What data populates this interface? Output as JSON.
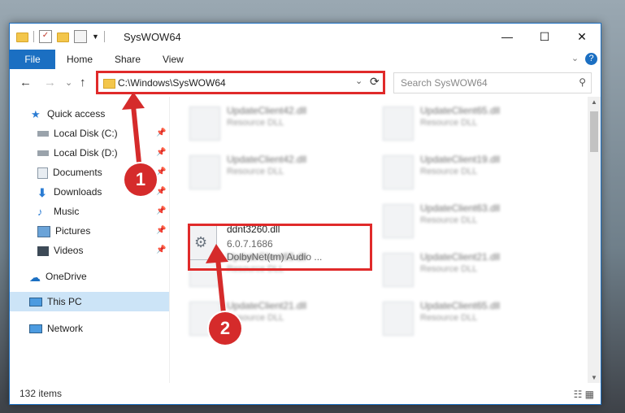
{
  "window": {
    "title": "SysWOW64",
    "controls": {
      "minimize": "—",
      "maximize": "☐",
      "close": "✕"
    }
  },
  "ribbon": {
    "tabs": [
      "File",
      "Home",
      "Share",
      "View"
    ],
    "expand": "⌄",
    "help": "?"
  },
  "navigation": {
    "back": "←",
    "forward": "→",
    "recent": "⌄",
    "up": "↑",
    "address": "C:\\Windows\\SysWOW64",
    "address_dropdown": "⌄",
    "refresh": "⟳",
    "search_placeholder": "Search SysWOW64"
  },
  "sidebar": {
    "items": [
      {
        "label": "Quick access",
        "icon": "star-icon"
      },
      {
        "label": "Local Disk (C:)",
        "icon": "drive-icon",
        "pinned": true
      },
      {
        "label": "Local Disk (D:)",
        "icon": "drive-icon",
        "pinned": true
      },
      {
        "label": "Documents",
        "icon": "documents-icon",
        "pinned": true
      },
      {
        "label": "Downloads",
        "icon": "download-icon",
        "pinned": true
      },
      {
        "label": "Music",
        "icon": "music-icon",
        "pinned": true
      },
      {
        "label": "Pictures",
        "icon": "pictures-icon",
        "pinned": true
      },
      {
        "label": "Videos",
        "icon": "videos-icon",
        "pinned": true
      },
      {
        "label": "OneDrive",
        "icon": "cloud-icon"
      },
      {
        "label": "This PC",
        "icon": "computer-icon",
        "selected": true
      },
      {
        "label": "Network",
        "icon": "network-icon"
      }
    ],
    "pin_glyph": "📌"
  },
  "files": {
    "blurred": [
      {
        "name": "UpdateClient42.dll",
        "type": "Resource DLL"
      },
      {
        "name": "UpdateClient65.dll",
        "type": "Resource DLL"
      },
      {
        "name": "UpdateClient42.dll",
        "type": "Resource DLL"
      },
      {
        "name": "UpdateClient19.dll",
        "type": "Resource DLL"
      },
      {
        "name": "UpdateClient63.dll",
        "type": "Resource DLL"
      },
      {
        "name": "UpdateClient63.dll",
        "type": "Resource DLL"
      },
      {
        "name": "UpdateClient21.dll",
        "type": "Resource DLL"
      },
      {
        "name": "UpdateClient21.dll",
        "type": "Resource DLL"
      },
      {
        "name": "UpdateClient65.dll",
        "type": "Resource DLL"
      }
    ],
    "highlighted": {
      "name": "ddnt3260.dll",
      "version": "6.0.7.1686",
      "description": "DolbyNet(tm) Audio ..."
    }
  },
  "status": {
    "count": "132 items",
    "view_icons": "☷ ▦"
  },
  "annotations": [
    {
      "number": "1"
    },
    {
      "number": "2"
    }
  ],
  "colors": {
    "accent": "#1b6fc2",
    "highlight": "#e02a2a",
    "selected": "#cce4f7"
  }
}
